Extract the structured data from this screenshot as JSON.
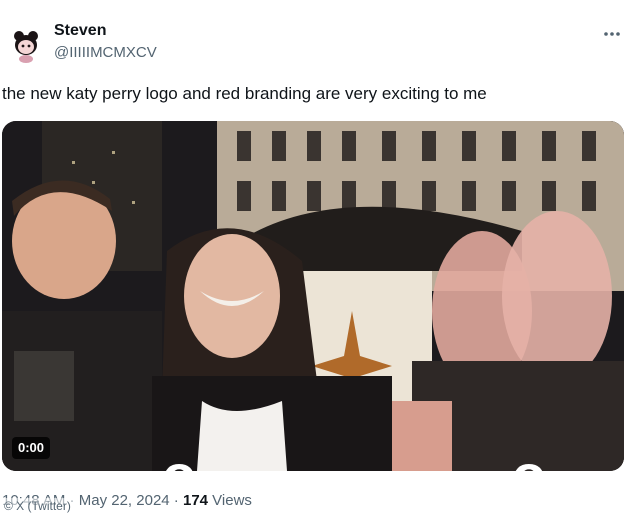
{
  "author": {
    "display_name": "Steven",
    "handle": "@IIIIIMCMXCV",
    "avatar_icon": "cartoon-character-avatar-icon"
  },
  "more_icon": "more-options-icon",
  "tweet": {
    "text": "the new katy perry logo and red branding are very exciting to me"
  },
  "media": {
    "duration": "0:00",
    "overlay_caption": "o o"
  },
  "meta": {
    "time": "10:48 AM",
    "separator": " · ",
    "date": "May 22, 2024",
    "views_count": "174",
    "views_label": " Views"
  },
  "watermark": "© X (Twitter)"
}
